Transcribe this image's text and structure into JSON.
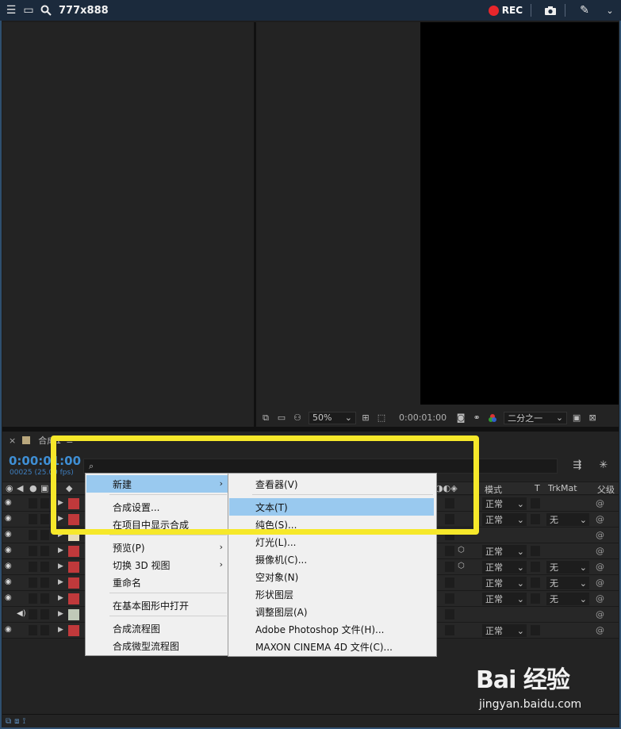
{
  "topbar": {
    "title": "777x888",
    "rec_label": "REC"
  },
  "viewer": {
    "zoom": "50%",
    "timecode": "0:00:01:00",
    "resolution": "二分之一"
  },
  "timeline": {
    "tab_close": "×",
    "tab_name": "合成1",
    "tab_menu": "≡",
    "timecode": "0:00:01:00",
    "frames": "00025 (25.00 fps)",
    "search_icon": "⌕",
    "columns": {
      "mode": "模式",
      "t": "T",
      "trkmat": "TrkMat",
      "parent": "父级"
    },
    "rows": [
      {
        "color": "#c0393b",
        "mode": "正常",
        "trkmat": "",
        "cube": false
      },
      {
        "color": "#c0393b",
        "mode": "正常",
        "trkmat": "无",
        "cube": false
      },
      {
        "color": "#e7dcb8",
        "mode": "",
        "trkmat": "",
        "cube": false
      },
      {
        "color": "#c0393b",
        "mode": "正常",
        "trkmat": "",
        "cube": true
      },
      {
        "color": "#c0393b",
        "mode": "正常",
        "trkmat": "无",
        "cube": true
      },
      {
        "color": "#c0393b",
        "mode": "正常",
        "trkmat": "无",
        "cube": false
      },
      {
        "color": "#c0393b",
        "mode": "正常",
        "trkmat": "无",
        "cube": false
      },
      {
        "color": "#c0c9b8",
        "mode": "",
        "trkmat": "",
        "cube": false
      },
      {
        "color": "#c0393b",
        "mode": "正常",
        "trkmat": "",
        "cube": false
      }
    ]
  },
  "context_menu": {
    "items": [
      {
        "label": "新建",
        "submenu": true
      },
      {
        "label": "合成设置..."
      },
      {
        "label": "在项目中显示合成"
      },
      {
        "label": "预览(P)",
        "submenu": true
      },
      {
        "label": "切换 3D 视图",
        "submenu": true
      },
      {
        "label": "重命名"
      },
      {
        "label": "在基本图形中打开"
      },
      {
        "label": "合成流程图"
      },
      {
        "label": "合成微型流程图"
      }
    ]
  },
  "submenu": {
    "items": [
      {
        "label": "查看器(V)"
      },
      {
        "label": "文本(T)"
      },
      {
        "label": "纯色(S)..."
      },
      {
        "label": "灯光(L)..."
      },
      {
        "label": "摄像机(C)..."
      },
      {
        "label": "空对象(N)"
      },
      {
        "label": "形状图层"
      },
      {
        "label": "调整图层(A)"
      },
      {
        "label": "Adobe Photoshop 文件(H)..."
      },
      {
        "label": "MAXON CINEMA 4D 文件(C)..."
      }
    ]
  },
  "watermark": {
    "brand": "Bai 经验",
    "url": "jingyan.baidu.com"
  },
  "colors": {
    "highlight": "#99c9ef",
    "yellow_box": "#f6e82a",
    "timecode": "#3f8fd5",
    "rec": "#e8262b"
  }
}
